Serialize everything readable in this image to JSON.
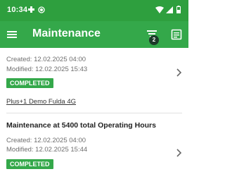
{
  "status_bar": {
    "time": "10:34"
  },
  "app_bar": {
    "title": "Maintenance",
    "filter_badge": "2"
  },
  "items": [
    {
      "created": "Created: 12.02.2025 04:00",
      "modified": "Modified: 12.02.2025 15:43",
      "status": "COMPLETED",
      "machine": "Plus+1 Demo Fulda 4G"
    },
    {
      "title": "Maintenance at 5400 total Operating Hours",
      "created": "Created: 12.02.2025 04:00",
      "modified": "Modified: 12.02.2025 15:44",
      "status": "COMPLETED"
    }
  ],
  "colors": {
    "primary": "#34a84a",
    "status_bar": "#2e9f3e",
    "badge": "#1d3a2a"
  },
  "icons": [
    "menu-icon",
    "filter-icon",
    "notes-icon",
    "chevron-right-icon"
  ]
}
